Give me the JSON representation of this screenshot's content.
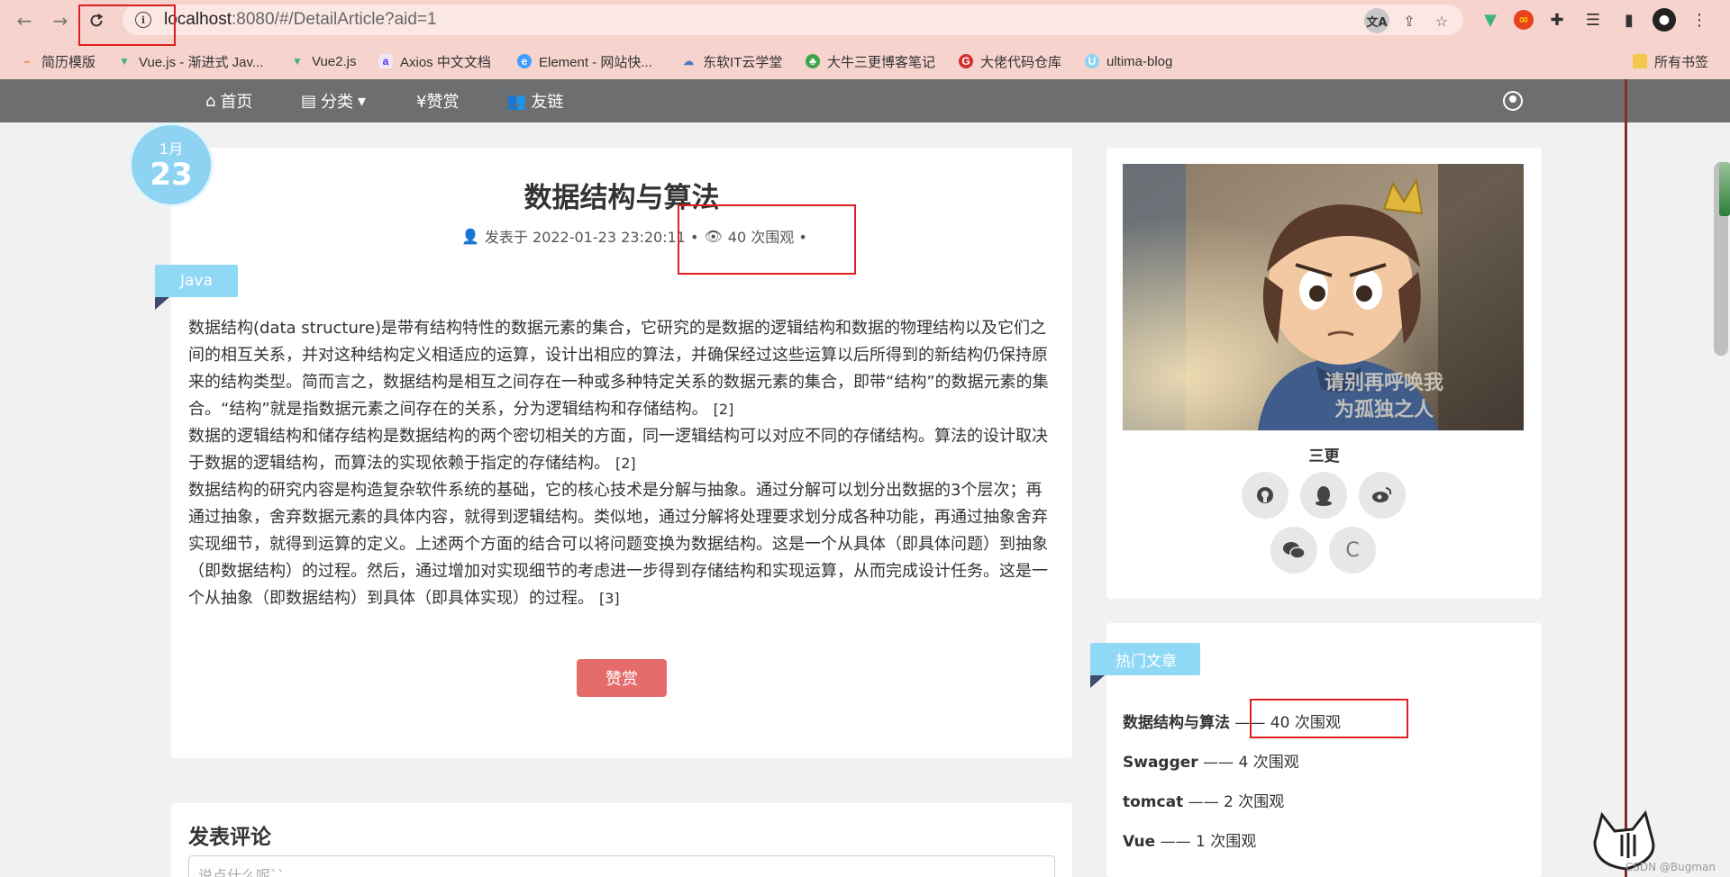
{
  "browser": {
    "url_host": "localhost",
    "url_path": ":8080/#/DetailArticle?aid=1",
    "bookmarks": [
      {
        "label": "简历模版"
      },
      {
        "label": "Vue.js - 渐进式 Jav..."
      },
      {
        "label": "Vue2.js"
      },
      {
        "label": "Axios 中文文档"
      },
      {
        "label": "Element - 网站快..."
      },
      {
        "label": "东软IT云学堂"
      },
      {
        "label": "大牛三更博客笔记"
      },
      {
        "label": "大佬代码仓库"
      },
      {
        "label": "ultima-blog"
      }
    ],
    "bookmarks_all": "所有书签"
  },
  "nav": {
    "home": "首页",
    "category": "分类",
    "reward": "¥赞赏",
    "links": "友链"
  },
  "article": {
    "month": "1月",
    "day": "23",
    "title": "数据结构与算法",
    "posted": "发表于 2022-01-23 23:20:11 •",
    "views": "40 次围观 •",
    "tag": "Java",
    "para1": "数据结构(data structure)是带有结构特性的数据元素的集合，它研究的是数据的逻辑结构和数据的物理结构以及它们之间的相互关系，并对这种结构定义相适应的运算，设计出相应的算法，并确保经过这些运算以后所得到的新结构仍保持原来的结构类型。简而言之，数据结构是相互之间存在一种或多种特定关系的数据元素的集合，即带“结构”的数据元素的集合。“结构”就是指数据元素之间存在的关系，分为逻辑结构和存储结构。",
    "ref1": "[2]",
    "para2": "数据的逻辑结构和储存结构是数据结构的两个密切相关的方面，同一逻辑结构可以对应不同的存储结构。算法的设计取决于数据的逻辑结构，而算法的实现依赖于指定的存储结构。",
    "ref2": "[2]",
    "para3": "数据结构的研究内容是构造复杂软件系统的基础，它的核心技术是分解与抽象。通过分解可以划分出数据的3个层次；再通过抽象，舍弃数据元素的具体内容，就得到逻辑结构。类似地，通过分解将处理要求划分成各种功能，再通过抽象舍弃实现细节，就得到运算的定义。上述两个方面的结合可以将问题变换为数据结构。这是一个从具体（即具体问题）到抽象（即数据结构）的过程。然后，通过增加对实现细节的考虑进一步得到存储结构和实现运算，从而完成设计任务。这是一个从抽象（即数据结构）到具体（即具体实现）的过程。",
    "ref3": "[3]",
    "reward_button": "赞赏"
  },
  "comment": {
    "title": "发表评论",
    "placeholder": "说点什么呢``"
  },
  "profile": {
    "name": "三更",
    "caption_line1": "请别再呼唤我",
    "caption_line2": "为孤独之人",
    "social_c": "C"
  },
  "hot": {
    "title": "热门文章",
    "items": [
      {
        "name": "数据结构与算法",
        "views": "—— 40 次围观"
      },
      {
        "name": "Swagger",
        "views": "—— 4 次围观"
      },
      {
        "name": "tomcat",
        "views": "—— 2 次围观"
      },
      {
        "name": "Vue",
        "views": "—— 1 次围观"
      }
    ]
  },
  "watermark": "CSDN @Bugman"
}
